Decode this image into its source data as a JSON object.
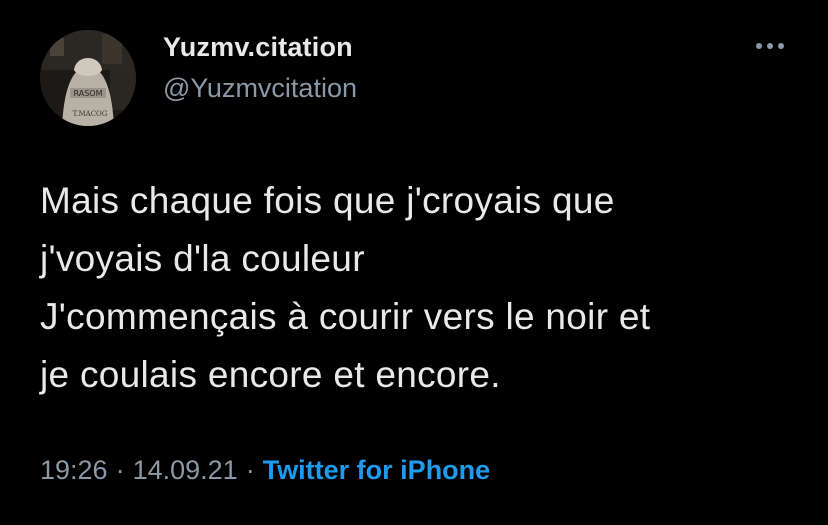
{
  "author": {
    "display_name": "Yuzmv.citation",
    "handle": "@Yuzmvcitation",
    "avatar_text_top": "RASOM",
    "avatar_text_bottom": "T.MACOG"
  },
  "tweet": {
    "lines": [
      "Mais chaque fois que j'croyais que",
      "j'voyais d'la couleur",
      "J'commençais à courir vers le noir et",
      "je coulais encore et encore."
    ]
  },
  "meta": {
    "time": "19:26",
    "separator": "·",
    "date": "14.09.21",
    "source": "Twitter for iPhone"
  },
  "colors": {
    "background": "#000000",
    "text": "#e7e9ea",
    "secondary": "#8b98a5",
    "link": "#1d9bf0"
  },
  "icons": {
    "more": "more-horizontal-icon"
  }
}
